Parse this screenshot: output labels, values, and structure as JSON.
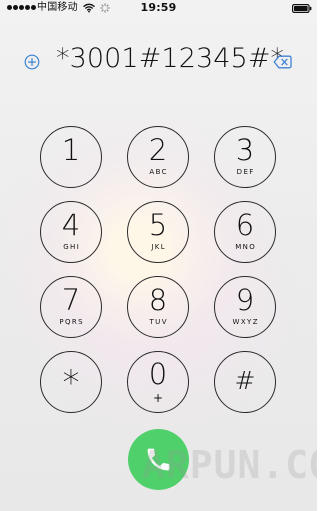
{
  "status_bar": {
    "carrier": "中国移动",
    "time": "19:59",
    "signal_icon": "signal-dots-icon",
    "wifi_icon": "wifi-icon",
    "activity_icon": "loading-spinner-icon",
    "battery_icon": "battery-icon"
  },
  "dialer": {
    "entry": "*3001#12345#*",
    "add_icon": "add-contact-icon",
    "delete_icon": "delete-icon",
    "keys": [
      {
        "id": "1",
        "label": "1",
        "letters": ""
      },
      {
        "id": "2",
        "label": "2",
        "letters": "ABC"
      },
      {
        "id": "3",
        "label": "3",
        "letters": "DEF"
      },
      {
        "id": "4",
        "label": "4",
        "letters": "GHI"
      },
      {
        "id": "5",
        "label": "5",
        "letters": "JKL"
      },
      {
        "id": "6",
        "label": "6",
        "letters": "MNO"
      },
      {
        "id": "7",
        "label": "7",
        "letters": "PQRS"
      },
      {
        "id": "8",
        "label": "8",
        "letters": "TUV"
      },
      {
        "id": "9",
        "label": "9",
        "letters": "WXYZ"
      },
      {
        "id": "star",
        "label": "*",
        "letters": ""
      },
      {
        "id": "0",
        "label": "0",
        "letters": "+"
      },
      {
        "id": "hash",
        "label": "#",
        "letters": ""
      }
    ],
    "call_icon": "phone-icon"
  },
  "watermark": "ARPUN.COM",
  "colors": {
    "accent_blue": "#3f83d4",
    "call_green": "#4fd06b",
    "text_dark": "#111111"
  }
}
